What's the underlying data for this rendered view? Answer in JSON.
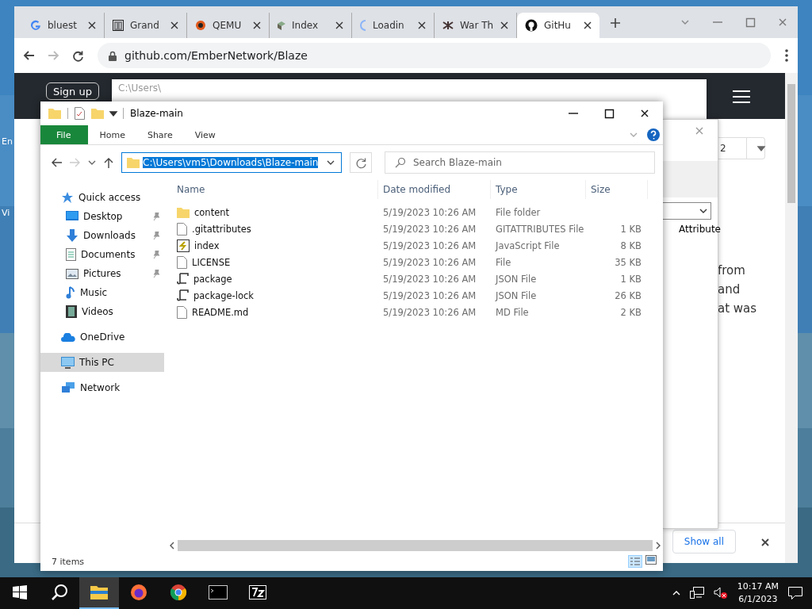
{
  "desktop": {
    "labels": [
      "En",
      "Vi"
    ]
  },
  "browser": {
    "tabs": [
      {
        "title": "bluest",
        "kind": "google",
        "selected": false
      },
      {
        "title": "Grand",
        "kind": "museum",
        "selected": false
      },
      {
        "title": "QEMU",
        "kind": "qemu",
        "selected": false
      },
      {
        "title": "Index",
        "kind": "pkg",
        "selected": false
      },
      {
        "title": "Loadin",
        "kind": "loading",
        "selected": false
      },
      {
        "title": "War Th",
        "kind": "bug",
        "selected": false
      },
      {
        "title": "GitHu",
        "kind": "github",
        "selected": true
      }
    ],
    "url": "github.com/EmberNetwork/Blaze",
    "page": {
      "sign_up": "Sign up",
      "text_lines": [
        "from",
        "and",
        "at was"
      ],
      "downloads_button": "Show all"
    }
  },
  "sevenzip": {
    "title": "C:\\Users\\"
  },
  "dialog": {
    "field_value": "2",
    "column": "Attribute"
  },
  "explorer": {
    "title": "Blaze-main",
    "ribbon_tabs": [
      {
        "label": "File",
        "kind": "file"
      },
      {
        "label": "Home",
        "kind": "tab"
      },
      {
        "label": "Share",
        "kind": "tab"
      },
      {
        "label": "View",
        "kind": "tab"
      }
    ],
    "address": "C:\\Users\\vm5\\Downloads\\Blaze-main",
    "search": {
      "placeholder": "Search Blaze-main"
    },
    "nav": [
      {
        "label": "Quick access",
        "kind": "star",
        "selected": false,
        "children": [
          {
            "label": "Desktop",
            "kind": "desktop",
            "pinned": true,
            "selected": false
          },
          {
            "label": "Downloads",
            "kind": "download",
            "pinned": true,
            "selected": false
          },
          {
            "label": "Documents",
            "kind": "doc",
            "pinned": true,
            "selected": false
          },
          {
            "label": "Pictures",
            "kind": "pic",
            "pinned": true,
            "selected": false
          },
          {
            "label": "Music",
            "kind": "music",
            "pinned": false,
            "selected": false
          },
          {
            "label": "Videos",
            "kind": "video",
            "pinned": false,
            "selected": false
          }
        ]
      },
      {
        "label": "OneDrive",
        "kind": "cloud",
        "selected": false
      },
      {
        "label": "This PC",
        "kind": "pc",
        "selected": true
      },
      {
        "label": "Network",
        "kind": "network",
        "selected": false
      }
    ],
    "columns": [
      "Name",
      "Date modified",
      "Type",
      "Size"
    ],
    "rows": [
      {
        "name": "content",
        "kind": "folder",
        "date": "5/19/2023 10:26 AM",
        "type": "File folder"
      },
      {
        "name": ".gitattributes",
        "kind": "file",
        "date": "5/19/2023 10:26 AM",
        "type": "GITATTRIBUTES File",
        "size": "1 KB"
      },
      {
        "name": "index",
        "kind": "script",
        "date": "5/19/2023 10:26 AM",
        "type": "JavaScript File",
        "size": "8 KB"
      },
      {
        "name": "LICENSE",
        "kind": "file",
        "date": "5/19/2023 10:26 AM",
        "type": "File",
        "size": "35 KB"
      },
      {
        "name": "package",
        "kind": "json",
        "date": "5/19/2023 10:26 AM",
        "type": "JSON File",
        "size": "1 KB"
      },
      {
        "name": "package-lock",
        "kind": "json",
        "date": "5/19/2023 10:26 AM",
        "type": "JSON File",
        "size": "26 KB"
      },
      {
        "name": "README.md",
        "kind": "file",
        "date": "5/19/2023 10:26 AM",
        "type": "MD File",
        "size": "2 KB"
      }
    ],
    "status": "7 items"
  },
  "taskbar": {
    "apps": [
      {
        "kind": "explorer",
        "selected": true
      },
      {
        "kind": "firefox",
        "selected": false
      },
      {
        "kind": "chrome",
        "selected": false
      },
      {
        "kind": "terminal",
        "selected": false
      },
      {
        "kind": "sevenzip",
        "selected": false
      }
    ],
    "time": "10:17 AM",
    "date": "6/1/2023"
  }
}
